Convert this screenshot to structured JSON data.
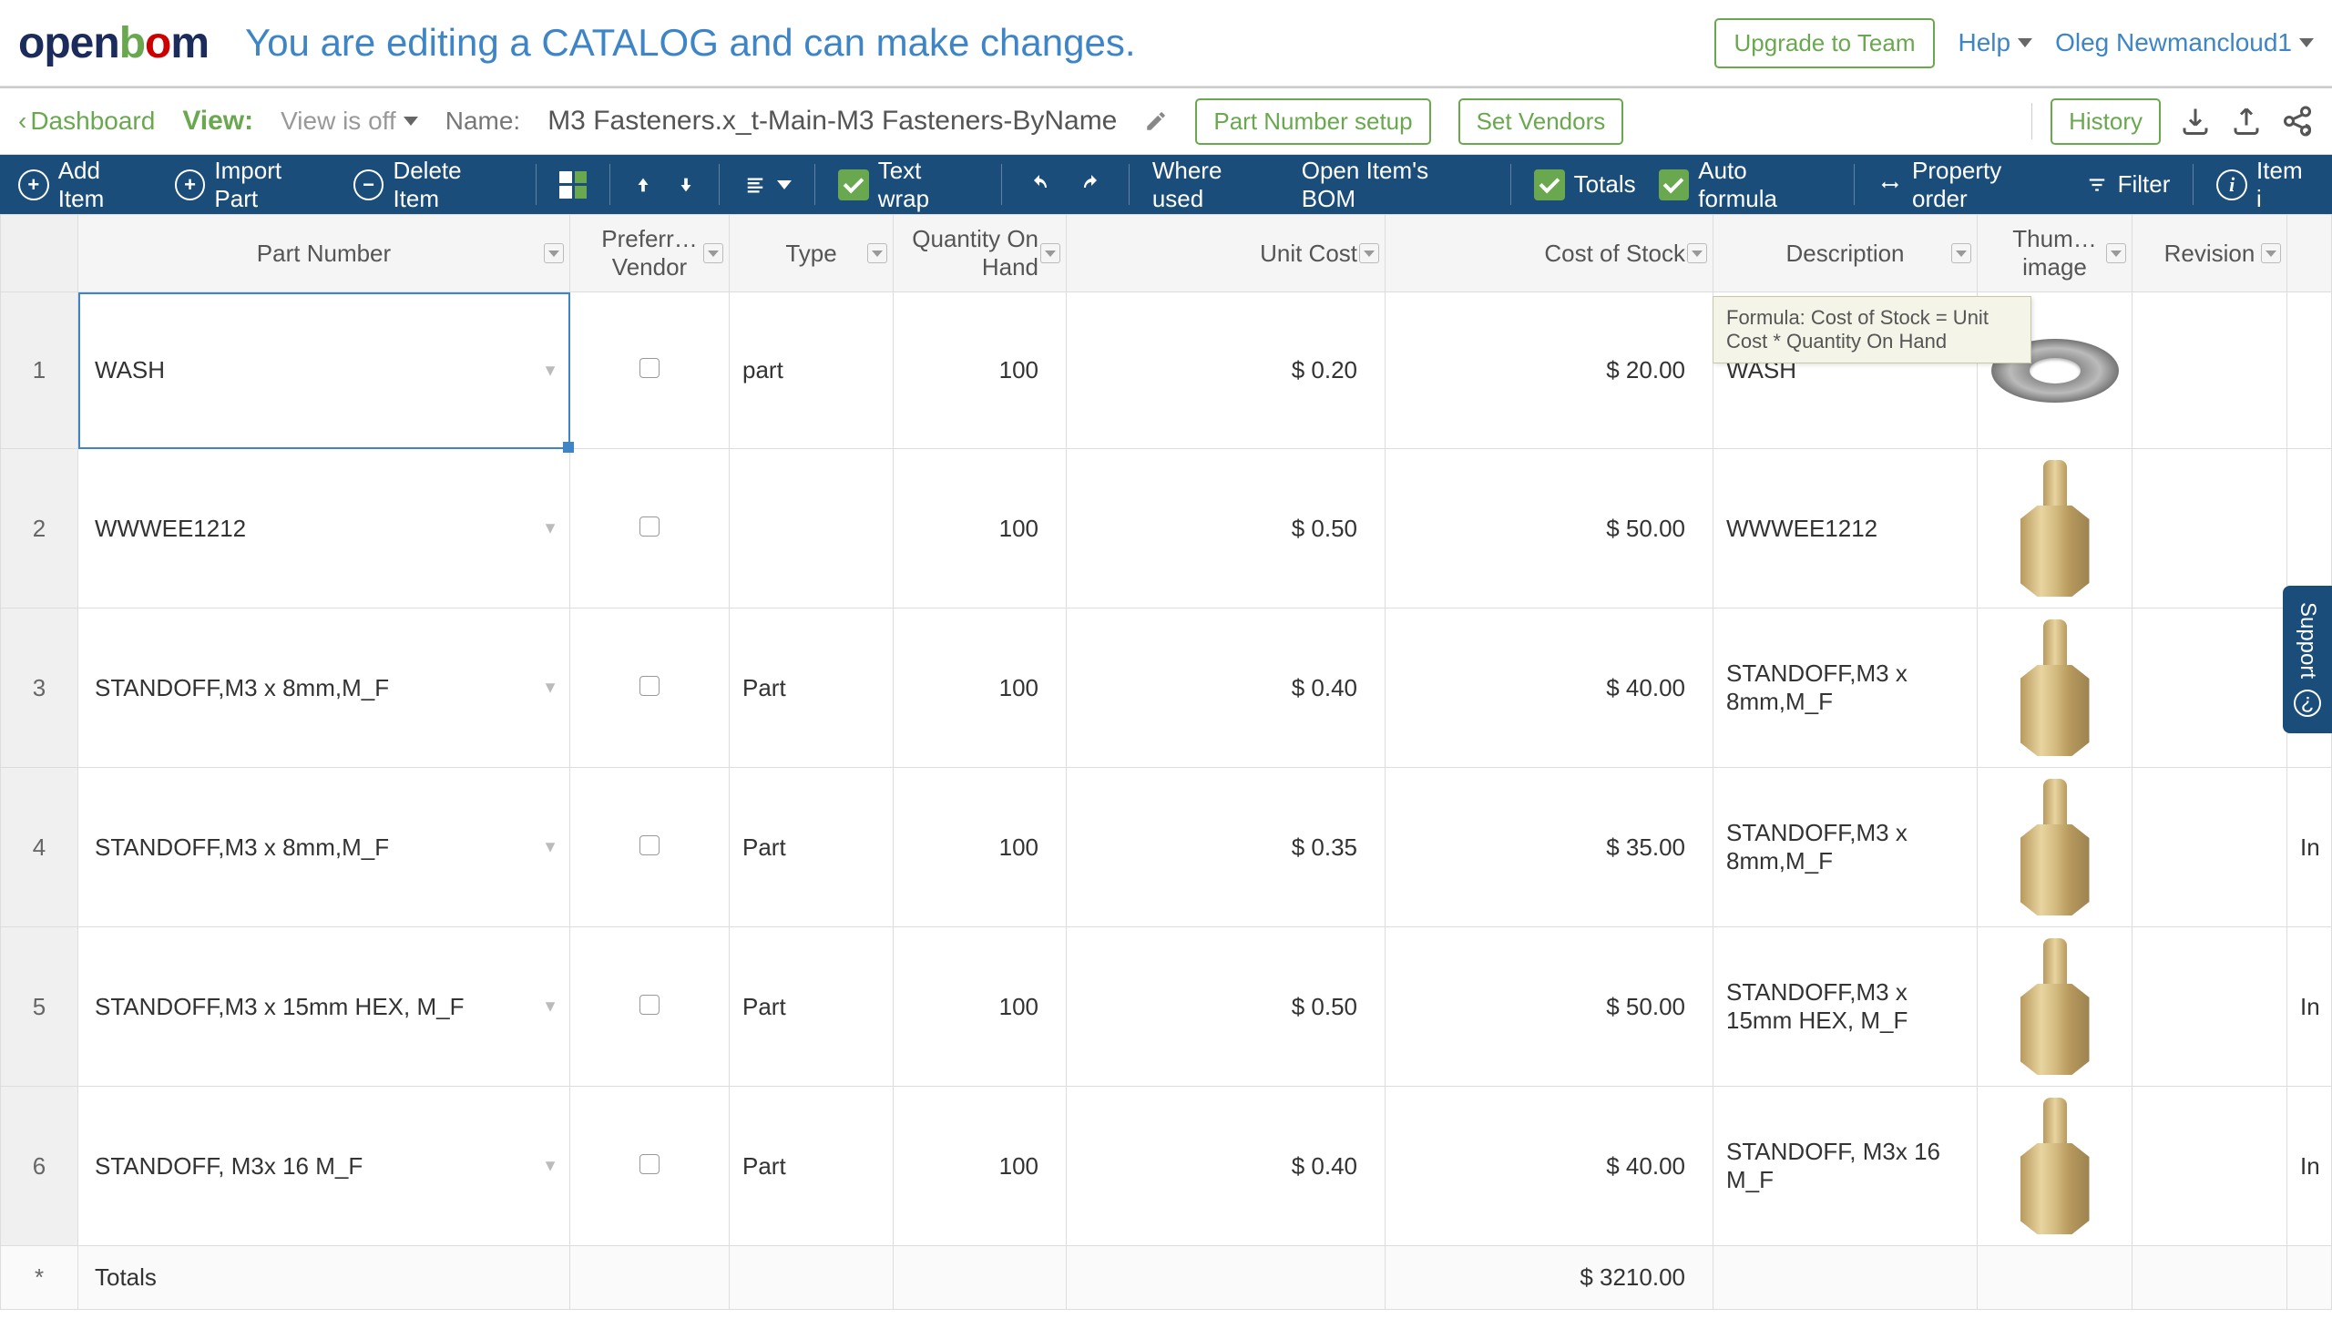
{
  "banner": {
    "message": "You are editing a CATALOG and can make changes.",
    "upgrade": "Upgrade to Team",
    "help": "Help",
    "user": "Oleg Newmancloud1"
  },
  "subheader": {
    "dashboard": "Dashboard",
    "view_label": "View:",
    "view_status": "View is off",
    "name_label": "Name:",
    "name_value": "M3 Fasteners.x_t-Main-M3 Fasteners-ByName",
    "part_number_setup": "Part Number setup",
    "set_vendors": "Set Vendors",
    "history": "History"
  },
  "toolbar": {
    "add_item": "Add Item",
    "import_part": "Import Part",
    "delete_item": "Delete Item",
    "text_wrap": "Text wrap",
    "where_used": "Where used",
    "open_items_bom": "Open Item's BOM",
    "totals": "Totals",
    "auto_formula": "Auto formula",
    "property_order": "Property order",
    "filter": "Filter",
    "item": "Item i"
  },
  "columns": {
    "part_number": "Part Number",
    "preferred_vendor": "Preferr… Vendor",
    "type": "Type",
    "qty_on_hand": "Quantity On Hand",
    "unit_cost": "Unit Cost",
    "cost_of_stock": "Cost of Stock",
    "description": "Description",
    "thumb": "Thum… image",
    "revision": "Revision"
  },
  "rows": [
    {
      "n": "1",
      "part": "WASH",
      "type": "part",
      "qty": "100",
      "unit": "$ 0.20",
      "cost": "$ 20.00",
      "desc": "WASH",
      "rev": "",
      "thumb": "washer"
    },
    {
      "n": "2",
      "part": "WWWEE1212",
      "type": "",
      "qty": "100",
      "unit": "$ 0.50",
      "cost": "$ 50.00",
      "desc": "WWWEE1212",
      "rev": "",
      "thumb": "standoff"
    },
    {
      "n": "3",
      "part": "STANDOFF,M3 x 8mm,M_F",
      "type": "Part",
      "qty": "100",
      "unit": "$ 0.40",
      "cost": "$ 40.00",
      "desc": "STANDOFF,M3 x 8mm,M_F",
      "rev": "",
      "thumb": "standoff"
    },
    {
      "n": "4",
      "part": "STANDOFF,M3 x 8mm,M_F",
      "type": "Part",
      "qty": "100",
      "unit": "$ 0.35",
      "cost": "$ 35.00",
      "desc": "STANDOFF,M3 x 8mm,M_F",
      "rev": "In",
      "thumb": "standoff"
    },
    {
      "n": "5",
      "part": "STANDOFF,M3 x 15mm HEX, M_F",
      "type": "Part",
      "qty": "100",
      "unit": "$ 0.50",
      "cost": "$ 50.00",
      "desc": "STANDOFF,M3 x 15mm HEX, M_F",
      "rev": "In",
      "thumb": "standoff"
    },
    {
      "n": "6",
      "part": "STANDOFF, M3x 16 M_F",
      "type": "Part",
      "qty": "100",
      "unit": "$ 0.40",
      "cost": "$ 40.00",
      "desc": "STANDOFF, M3x 16 M_F",
      "rev": "In",
      "thumb": "standoff"
    }
  ],
  "totals": {
    "label": "Totals",
    "star": "*",
    "cost": "$ 3210.00"
  },
  "tooltip": "Formula: Cost of Stock = Unit Cost * Quantity On Hand",
  "support": "Support"
}
